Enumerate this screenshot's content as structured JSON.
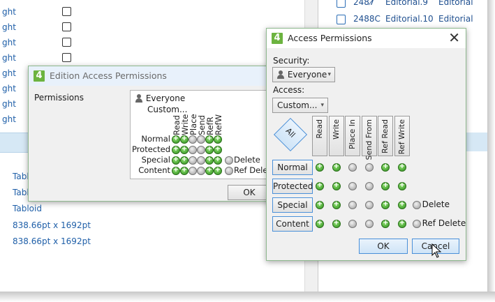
{
  "background": {
    "left_rows": [
      "ght",
      "ght",
      "ght",
      "ght",
      "ght",
      "ght",
      "ght",
      "ght"
    ],
    "left_items": [
      "Tabl",
      "Tabl",
      "Tabloid",
      "838.66pt x 1692pt",
      "838.66pt x 1692pt"
    ],
    "right_rows": [
      {
        "num": "2487̸",
        "name": "Editorial.9",
        "col": "Editorial"
      },
      {
        "num": "2488C",
        "name": "Editorial.10",
        "col": "Editorial"
      }
    ]
  },
  "edition_dialog": {
    "title": "Edition Access Permissions",
    "permissions_label": "Permissions",
    "user": "Everyone",
    "custom": "Custom...",
    "columns": [
      "Read",
      "Write",
      "Place",
      "Send",
      "RefR",
      "RefW"
    ],
    "rows": [
      {
        "label": "Normal",
        "states": [
          "g",
          "g",
          "x",
          "x",
          "g",
          "g"
        ],
        "extra": ""
      },
      {
        "label": "Protected",
        "states": [
          "g",
          "g",
          "x",
          "x",
          "g",
          "g"
        ],
        "extra": ""
      },
      {
        "label": "Special",
        "states": [
          "g",
          "g",
          "x",
          "x",
          "g",
          "g"
        ],
        "extra": "Delete"
      },
      {
        "label": "Content",
        "states": [
          "g",
          "g",
          "x",
          "x",
          "g",
          "g"
        ],
        "extra": "Ref Delete"
      }
    ],
    "ok": "OK"
  },
  "access_dialog": {
    "title": "Access Permissions",
    "security_label": "Security:",
    "security_value": "Everyone",
    "access_label": "Access:",
    "access_value": "Custom...",
    "all_button": "All",
    "columns": [
      "Read",
      "Write",
      "Place In",
      "Send From",
      "Ref Read",
      "Ref Write"
    ],
    "rows": [
      {
        "label": "Normal",
        "states": [
          "g",
          "g",
          "x",
          "x",
          "g",
          "g"
        ],
        "extra": ""
      },
      {
        "label": "Protected",
        "states": [
          "g",
          "g",
          "x",
          "x",
          "g",
          "g"
        ],
        "extra": ""
      },
      {
        "label": "Special",
        "states": [
          "g",
          "g",
          "x",
          "x",
          "g",
          "g"
        ],
        "extra": "Delete"
      },
      {
        "label": "Content",
        "states": [
          "g",
          "g",
          "x",
          "x",
          "g",
          "g"
        ],
        "extra": "Ref Delete"
      }
    ],
    "ok": "OK",
    "cancel": "Cancel"
  }
}
